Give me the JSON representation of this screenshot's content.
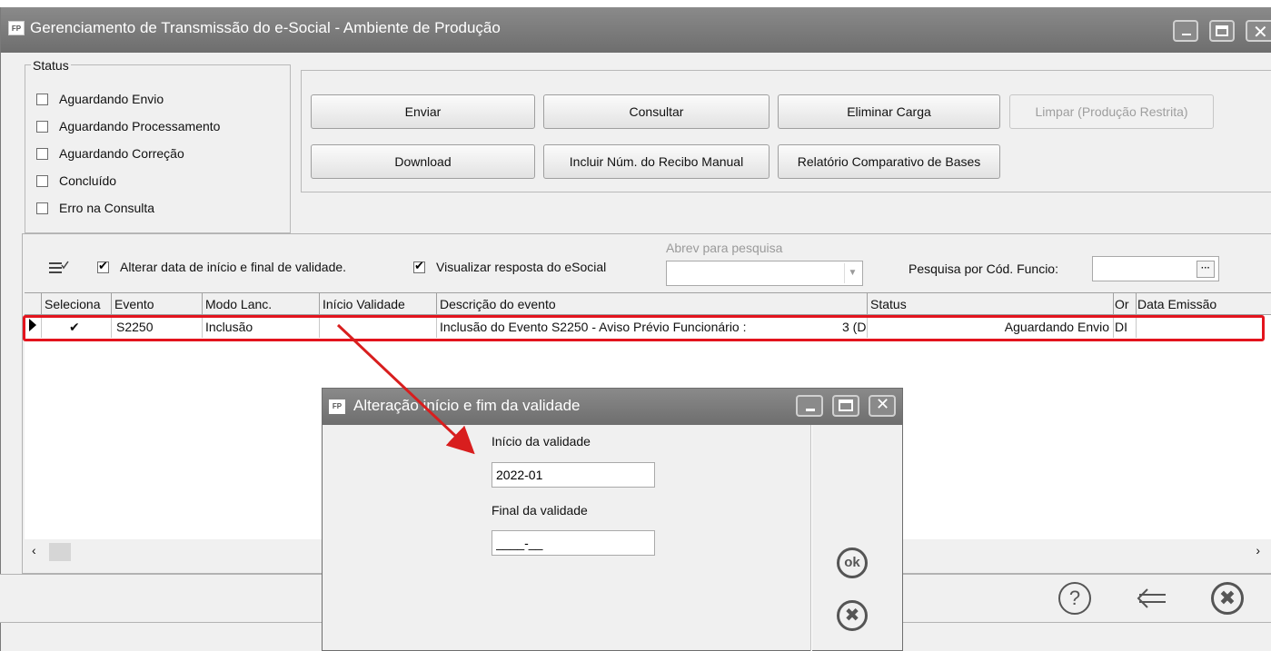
{
  "window": {
    "logo": "FP",
    "title": "Gerenciamento de Transmissão do e-Social - Ambiente de Produção"
  },
  "status": {
    "legend": "Status",
    "items": [
      {
        "label": "Aguardando Envio",
        "checked": false
      },
      {
        "label": "Aguardando Processamento",
        "checked": false
      },
      {
        "label": "Aguardando Correção",
        "checked": false
      },
      {
        "label": "Concluído",
        "checked": false
      },
      {
        "label": "Erro na Consulta",
        "checked": false
      }
    ]
  },
  "actions": {
    "enviar": "Enviar",
    "consultar": "Consultar",
    "eliminar": "Eliminar Carga",
    "limpar": "Limpar (Produção Restrita)",
    "download": "Download",
    "incluir": "Incluir Núm. do Recibo Manual",
    "relatorio": "Relatório Comparativo de Bases"
  },
  "options": {
    "alterar_data": "Alterar data de início e final de validade.",
    "visualizar": "Visualizar resposta do eSocial",
    "abrev_label": "Abrev para pesquisa",
    "pesquisa_label": "Pesquisa por Cód. Funcio:"
  },
  "table": {
    "columns": [
      "Seleciona",
      "Evento",
      "Modo Lanc.",
      "Início Validade",
      "Descrição do evento",
      "Status",
      "Or",
      "Data Emissão"
    ],
    "rows": [
      {
        "selected": "✔",
        "evento": "S2250",
        "modo": "Inclusão",
        "inicio": "",
        "descricao": "Inclusão do Evento S2250 - Aviso Prévio Funcionário :",
        "descricao_suffix": "3 (D",
        "status": "Aguardando Envio",
        "or": "DI",
        "data": ""
      }
    ]
  },
  "dialog": {
    "logo": "FP",
    "title": "Alteração início e fim da validade",
    "inicio_label": "Início da validade",
    "inicio_value": "2022-01",
    "final_label": "Final da validade",
    "final_value": "____-__",
    "ok_label": "ok"
  },
  "colors": {
    "titlebar": "#7c7c7c",
    "highlight": "#e3141d",
    "arrow": "#d81e1e"
  }
}
